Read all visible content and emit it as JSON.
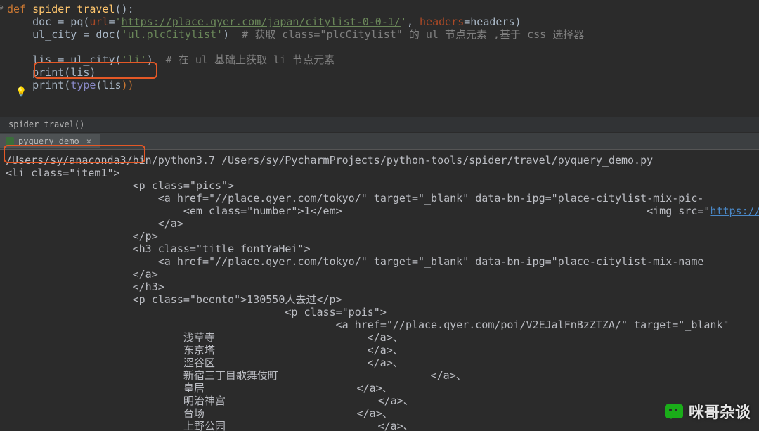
{
  "editor": {
    "l1_kw": "def ",
    "l1_fn": "spider_travel",
    "l1_paren": "():",
    "l2_pre": "    doc = pq(",
    "l2_p1": "url",
    "l2_eq": "=",
    "l2_q1": "'",
    "l2_url": "https://place.qyer.com/japan/citylist-0-0-1/",
    "l2_q2": "'",
    "l2_comma": ", ",
    "l2_p2": "headers",
    "l2_tail": "=headers)",
    "l3_pre": "    ul_city = doc(",
    "l3_str": "'ul.plcCitylist'",
    "l3_close": ")  ",
    "l3_comment": "# 获取 class=\"plcCitylist\" 的 ul 节点元素 ,基于 css 选择器",
    "l5_pre": "    lis = ul_city(",
    "l5_str": "'li'",
    "l5_close": ")  ",
    "l5_comment": "# 在 ul 基础上获取 li 节点元素",
    "l6": "    print(lis)",
    "l7_pre": "    print(",
    "l7_type": "type",
    "l7_mid": "(lis",
    "l7_close": "))"
  },
  "breadcrumb": "spider_travel()",
  "tab": "pyquery_demo",
  "out": {
    "l1": "/Users/sy/anaconda3/bin/python3.7 /Users/sy/PycharmProjects/python-tools/spider/travel/pyquery_demo.py",
    "l2": "<li class=\"item1\">",
    "l3": "                    <p class=\"pics\">",
    "l4a": "                        <a href=\"//place.qyer.com/tokyo/\" target=\"_blank\" data-bn-ipg=\"place-citylist-mix-pic-",
    "l5a": "                            <em class=\"number\">1</em>                                                <img src=\"",
    "l5b": "https://pic.qyer.co",
    "l6": "                        </a>",
    "l7": "                    </p>",
    "l8": "                    <h3 class=\"title fontYaHei\">",
    "l9": "                        <a href=\"//place.qyer.com/tokyo/\" target=\"_blank\" data-bn-ipg=\"place-citylist-mix-name",
    "l10": "                    </a>",
    "l11": "                    </h3>",
    "l12": "                    <p class=\"beento\">130550人去过</p>",
    "l13": "",
    "l14": "                                            <p class=\"pois\">",
    "l15": "                                                    <a href=\"//place.qyer.com/poi/V2EJalFnBzZTZA/\" target=\"_blank\"",
    "l16": "                            浅草寺                        </a>、",
    "l17": "                            东京塔                        </a>、",
    "l18": "                            涩谷区                        </a>、",
    "l19": "                            新宿三丁目歌舞伎町                        </a>、",
    "l20": "                            皇居                        </a>、",
    "l21": "                            明治神宫                        </a>、",
    "l22": "                            台场                        </a>、",
    "l23": "                            上野公园                        </a>、"
  },
  "watermark": "咪哥杂谈"
}
